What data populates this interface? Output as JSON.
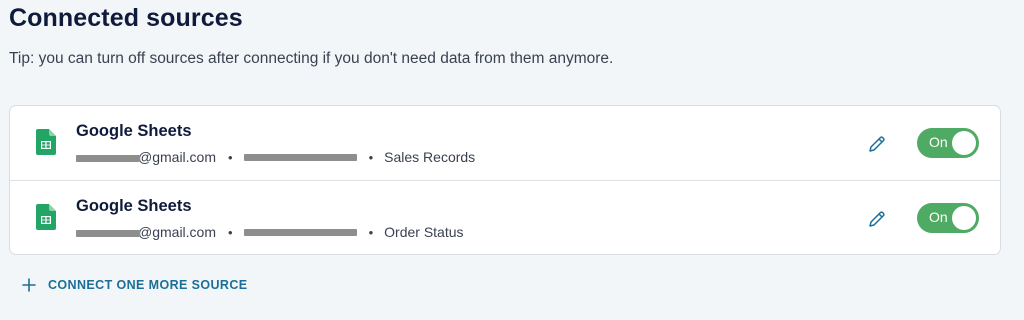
{
  "header": {
    "title": "Connected sources",
    "tip": "Tip: you can turn off sources after connecting if you don't need data from them anymore."
  },
  "sources": [
    {
      "icon": "google-sheets-icon",
      "name": "Google Sheets",
      "account_suffix": "@gmail.com",
      "separator": "•",
      "sheet": "Sales Records",
      "toggle_label": "On",
      "toggle_on": true
    },
    {
      "icon": "google-sheets-icon",
      "name": "Google Sheets",
      "account_suffix": "@gmail.com",
      "separator": "•",
      "sheet": "Order Status",
      "toggle_label": "On",
      "toggle_on": true
    }
  ],
  "actions": {
    "connect_more_label": "CONNECT ONE MORE SOURCE"
  },
  "colors": {
    "toggle_on": "#4faa63",
    "link": "#1b6f96",
    "title": "#101a3a",
    "sheets_green": "#23a566"
  }
}
